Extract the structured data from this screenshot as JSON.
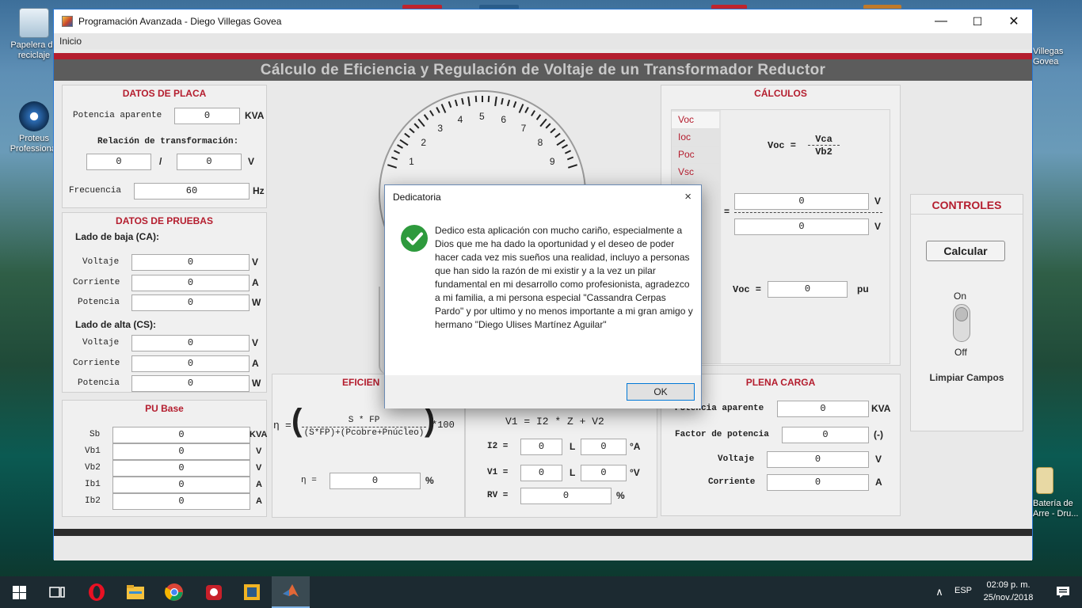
{
  "desktop": {
    "icons_left": [
      {
        "label": "Papelera de reciclaje",
        "icon": "recycle-bin-icon"
      },
      {
        "label": "Proteus Professional",
        "icon": "proteus-icon"
      }
    ],
    "icons_right": [
      {
        "label": "Villegas Govea",
        "icon": "folder-icon"
      },
      {
        "label": "Batería de Arre - Dru...",
        "icon": "file-icon"
      }
    ]
  },
  "window": {
    "title": "Programación Avanzada - Diego Villegas Govea",
    "minimize": "—",
    "maximize": "☐",
    "close": "✕",
    "menu": [
      "Inicio"
    ]
  },
  "app": {
    "header": "Cálculo de Eficiencia y Regulación de Voltaje de un Transformador Reductor",
    "colors": {
      "accent": "#b41d2e",
      "header_bg": "#5c5c5c",
      "panel_bg": "#f0f0f0"
    },
    "datos_placa": {
      "title": "DATOS DE PLACA",
      "potencia_label": "Potencia aparente",
      "potencia_value": "0",
      "potencia_unit": "KVA",
      "relacion_label": "Relación de transformación:",
      "rel_a": "0",
      "rel_sep": "/",
      "rel_b": "0",
      "rel_unit": "V",
      "frecuencia_label": "Frecuencia",
      "frecuencia_value": "60",
      "frecuencia_unit": "Hz"
    },
    "datos_pruebas": {
      "title": "DATOS DE PRUEBAS",
      "baja_label": "Lado de baja (CA):",
      "alta_label": "Lado de alta (CS):",
      "baja": [
        {
          "label": "Voltaje",
          "value": "0",
          "unit": "V"
        },
        {
          "label": "Corriente",
          "value": "0",
          "unit": "A"
        },
        {
          "label": "Potencia",
          "value": "0",
          "unit": "W"
        }
      ],
      "alta": [
        {
          "label": "Voltaje",
          "value": "0",
          "unit": "V"
        },
        {
          "label": "Corriente",
          "value": "0",
          "unit": "A"
        },
        {
          "label": "Potencia",
          "value": "0",
          "unit": "W"
        }
      ]
    },
    "pu_base": {
      "title": "PU Base",
      "rows": [
        {
          "label": "Sb",
          "value": "0",
          "unit": "KVA"
        },
        {
          "label": "Vb1",
          "value": "0",
          "unit": "V"
        },
        {
          "label": "Vb2",
          "value": "0",
          "unit": "V"
        },
        {
          "label": "Ib1",
          "value": "0",
          "unit": "A"
        },
        {
          "label": "Ib2",
          "value": "0",
          "unit": "A"
        }
      ]
    },
    "gauge": {
      "numbers": [
        "1",
        "2",
        "3",
        "4",
        "5",
        "6",
        "7",
        "8",
        "9"
      ]
    },
    "eficiencia": {
      "title": "EFICIEN",
      "eta": "η",
      "eq_sign": "=",
      "numerator": "S * FP",
      "denominator": "(S*FP)+(Pcobre+Pnúcleo)",
      "times": "*100",
      "result_label": "η =",
      "result_value": "0",
      "result_unit": "%"
    },
    "regulacion": {
      "eq": "V1 = I2 * Z + V2",
      "i2_label": "I2 =",
      "i2_mag": "0",
      "i2_ang_sym": "L",
      "i2_ang": "0",
      "i2_unit": "°A",
      "v1_label": "V1 =",
      "v1_mag": "0",
      "v1_ang_sym": "L",
      "v1_ang": "0",
      "v1_unit": "°V",
      "rv_label": "RV =",
      "rv_value": "0",
      "rv_unit": "%"
    },
    "calculos": {
      "title": "CÁLCULOS",
      "tabs": [
        "Voc",
        "Ioc",
        "Poc",
        "Vsc"
      ],
      "formula_left": "Voc =",
      "formula_num": "Vca",
      "formula_den": "Vb2",
      "eq_sign": "=",
      "num_value": "0",
      "num_unit": "V",
      "den_value": "0",
      "den_unit": "V",
      "result_label": "Voc =",
      "result_value": "0",
      "result_unit": "pu"
    },
    "plena_carga": {
      "title": "PLENA CARGA",
      "rows": [
        {
          "label": "Potencia aparente",
          "value": "0",
          "unit": "KVA"
        },
        {
          "label": "Factor de potencia",
          "value": "0",
          "unit": "(-)"
        },
        {
          "label": "Voltaje",
          "value": "0",
          "unit": "V"
        },
        {
          "label": "Corriente",
          "value": "0",
          "unit": "A"
        }
      ]
    },
    "controles": {
      "title": "CONTROLES",
      "calcular": "Calcular",
      "on": "On",
      "off": "Off",
      "limpiar": "Limpiar Campos"
    }
  },
  "dialog": {
    "title": "Dedicatoria",
    "close": "×",
    "message": "Dedico esta aplicación con mucho cariño, especialmente a Dios que me ha dado la oportunidad y el deseo de poder hacer cada vez mis sueños una realidad, incluyo a personas que han sido la razón de mi existir y a la vez un pilar fundamental en mi desarrollo como profesionista, agradezco a mi familia, a mi persona especial \"Cassandra Cerpas Pardo\" y por ultimo y no menos importante a mi gran amigo y hermano \"Diego Ulises Martínez Aguilar\"",
    "ok": "OK",
    "icon": "success-check-icon"
  },
  "taskbar": {
    "apps": [
      "windows-start-icon",
      "task-view-icon",
      "opera-icon",
      "file-explorer-icon",
      "chrome-icon",
      "app-red-icon",
      "app-yellow-icon",
      "matlab-icon"
    ],
    "language": "ESP",
    "time": "02:09 p. m.",
    "date": "25/nov./2018"
  }
}
